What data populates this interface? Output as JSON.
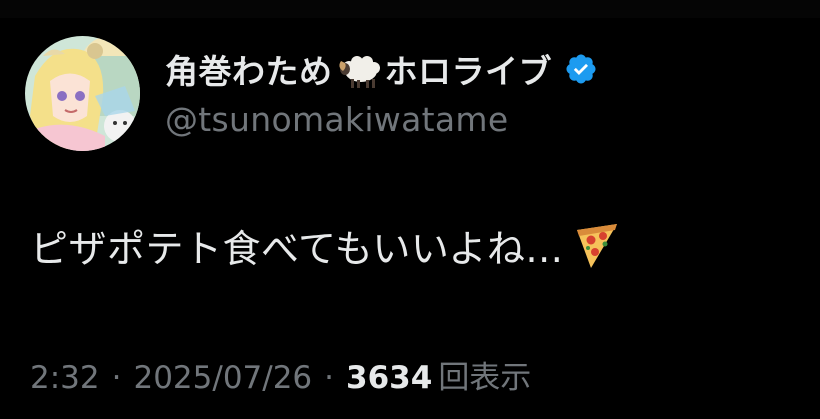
{
  "author": {
    "display_name": "角巻わため",
    "display_name_suffix": "ホロライブ",
    "handle": "@tsunomakiwatame",
    "name_emoji": "sheep-icon",
    "verified_badge": "verified-icon",
    "verified_color": "#1d9bf0"
  },
  "tweet": {
    "text": "ピザポテト食べてもいいよね...",
    "emoji": "pizza-icon"
  },
  "meta": {
    "time": "2:32",
    "separator": "·",
    "date": "2025/07/26",
    "views_count": "3634",
    "views_label": "回表示"
  },
  "colors": {
    "background": "#000000",
    "primary_text": "#e7e9ea",
    "secondary_text": "#71767b",
    "accent": "#1d9bf0"
  }
}
